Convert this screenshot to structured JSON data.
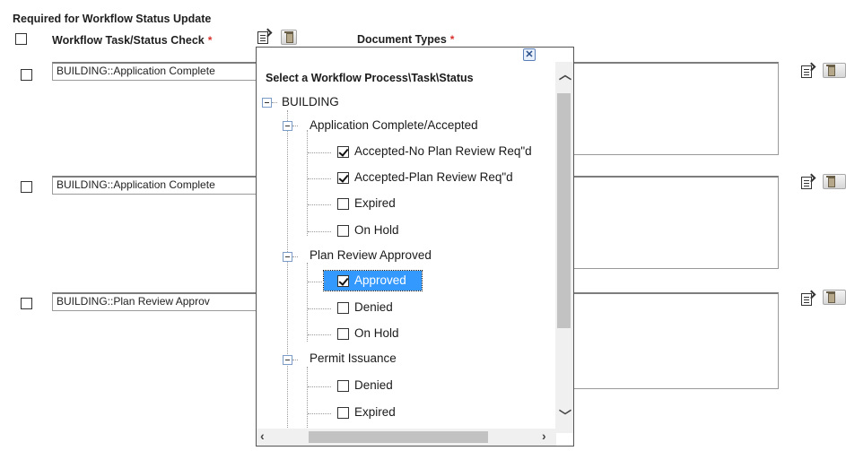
{
  "header": {
    "section_title": "Required for Workflow Status Update",
    "col_task": "Workflow Task/Status Check",
    "col_task_required": "*",
    "col_docs": "Document Types",
    "col_docs_required": "*"
  },
  "rows": [
    {
      "value": "BUILDING::Application Complete"
    },
    {
      "value": "BUILDING::Application Complete"
    },
    {
      "value": "BUILDING::Plan Review Approv"
    }
  ],
  "popup": {
    "title": "Select a Workflow Process\\Task\\Status",
    "close_glyph": "✕",
    "root": "BUILDING",
    "tasks": [
      {
        "label": "Application Complete/Accepted",
        "statuses": [
          {
            "label": "Accepted-No Plan Review Req\"d",
            "checked": true
          },
          {
            "label": "Accepted-Plan Review Req\"d",
            "checked": true
          },
          {
            "label": "Expired",
            "checked": false
          },
          {
            "label": "On Hold",
            "checked": false
          }
        ]
      },
      {
        "label": "Plan Review Approved",
        "statuses": [
          {
            "label": "Approved",
            "checked": true,
            "selected": true
          },
          {
            "label": "Denied",
            "checked": false
          },
          {
            "label": "On Hold",
            "checked": false
          }
        ]
      },
      {
        "label": "Permit Issuance",
        "statuses": [
          {
            "label": "Denied",
            "checked": false
          },
          {
            "label": "Expired",
            "checked": false
          }
        ]
      }
    ]
  },
  "icons": {
    "edit": "edit-document-icon",
    "delete": "trash-icon"
  }
}
